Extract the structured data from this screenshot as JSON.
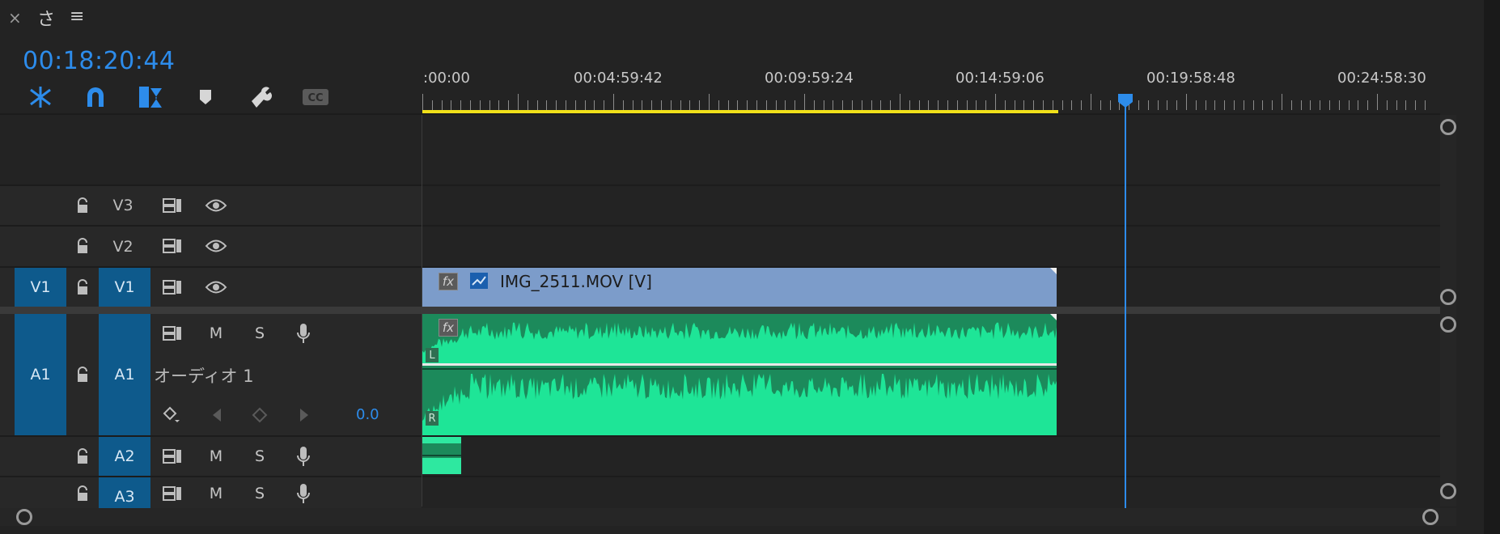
{
  "panel": {
    "close_glyph": "×",
    "title": "さ",
    "menu_glyph": "≡"
  },
  "timecode": "00:18:20:44",
  "toolbar": {
    "tools": [
      {
        "name": "insert-nest-icon",
        "active": true
      },
      {
        "name": "snap-magnet-icon",
        "active": true
      },
      {
        "name": "linked-selection-icon",
        "active": true
      },
      {
        "name": "add-marker-icon",
        "active": false
      },
      {
        "name": "wrench-settings-icon",
        "active": false
      },
      {
        "name": "captions-cc-icon",
        "active": false
      }
    ]
  },
  "ruler": {
    "labels": [
      ":00:00",
      "00:04:59:42",
      "00:09:59:24",
      "00:14:59:06",
      "00:19:58:48",
      "00:24:58:30"
    ]
  },
  "tracks": {
    "video": [
      {
        "id": "V3",
        "label": "V3",
        "source_target": "",
        "targeted": false
      },
      {
        "id": "V2",
        "label": "V2",
        "source_target": "",
        "targeted": false
      },
      {
        "id": "V1",
        "label": "V1",
        "source_target": "V1",
        "targeted": true
      }
    ],
    "audio": [
      {
        "id": "A1",
        "label": "A1",
        "source_target": "A1",
        "targeted": true,
        "name": "オーディオ 1",
        "volume": "0.0"
      },
      {
        "id": "A2",
        "label": "A2",
        "source_target": "",
        "targeted": true
      },
      {
        "id": "A3",
        "label": "A3",
        "source_target": "",
        "targeted": true
      }
    ],
    "mute_label": "M",
    "solo_label": "S"
  },
  "clips": {
    "video_clip_name": "IMG_2511.MOV [V]",
    "fx_label": "fx",
    "left_channel": "L",
    "right_channel": "R"
  },
  "colors": {
    "accent_blue": "#2d8ceb",
    "video_clip": "#7c9cca",
    "audio_clip": "#1c8a5b",
    "waveform": "#1ee597",
    "work_area": "#f1e11a",
    "target_blue": "#0e5a8c"
  }
}
